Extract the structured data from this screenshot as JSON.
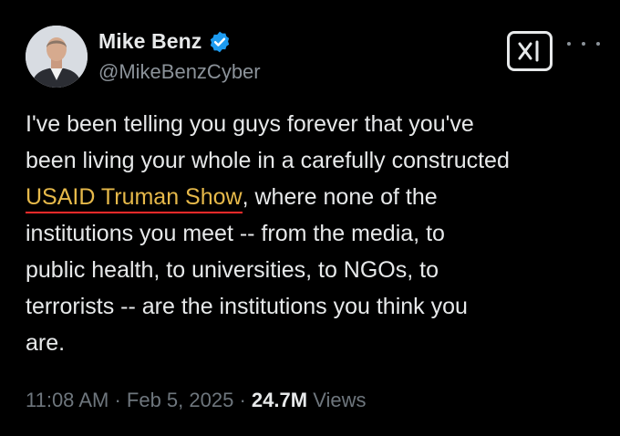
{
  "author": {
    "display_name": "Mike Benz",
    "handle": "@MikeBenzCyber",
    "verified_badge_icon": "verified-badge-icon",
    "verified_color": "#1d9bf0"
  },
  "actions": {
    "grok_icon": "grok-icon",
    "more_icon": "more-dots-icon"
  },
  "tweet": {
    "line1": "I've been telling you guys forever that you've",
    "line2": "been living your whole in a carefully constructed",
    "line3_highlight": "USAID Truman Show",
    "line3_rest": ", where none of the",
    "line4": "institutions you meet -- from the media, to",
    "line5": "public health, to universities, to NGOs, to",
    "line6": "terrorists -- are the institutions you think you",
    "line7": "are.",
    "highlight_color": "#e6b94a",
    "underline_color": "#ff2a2a"
  },
  "meta": {
    "time": "11:08 AM",
    "sep1": "·",
    "date": "Feb 5, 2025",
    "sep2": "·",
    "views_count": "24.7M",
    "views_label": "Views"
  }
}
